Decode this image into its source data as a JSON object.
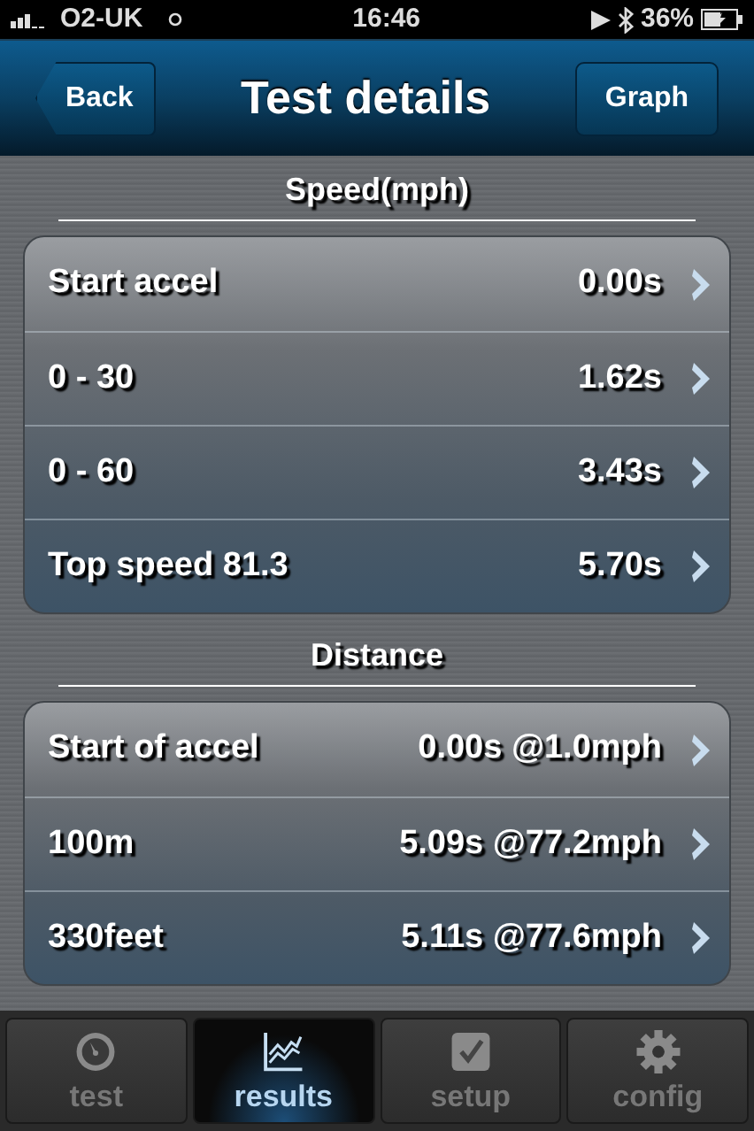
{
  "status_bar": {
    "carrier": "O2-UK",
    "time": "16:46",
    "battery": "36%"
  },
  "nav": {
    "back": "Back",
    "title": "Test details",
    "action": "Graph"
  },
  "sections": [
    {
      "title": "Speed(mph)",
      "rows": [
        {
          "label": "Start accel",
          "value": "0.00s"
        },
        {
          "label": "0 - 30",
          "value": "1.62s"
        },
        {
          "label": "0 - 60",
          "value": "3.43s"
        },
        {
          "label": "Top speed 81.3",
          "value": "5.70s"
        }
      ]
    },
    {
      "title": "Distance",
      "rows": [
        {
          "label": "Start of accel",
          "value": "0.00s @1.0mph"
        },
        {
          "label": "100m",
          "value": "5.09s @77.2mph"
        },
        {
          "label": "330feet",
          "value": "5.11s @77.6mph"
        }
      ]
    }
  ],
  "tab_bar": [
    {
      "label": "test",
      "selected": false
    },
    {
      "label": "results",
      "selected": true
    },
    {
      "label": "setup",
      "selected": false
    },
    {
      "label": "config",
      "selected": false
    }
  ]
}
